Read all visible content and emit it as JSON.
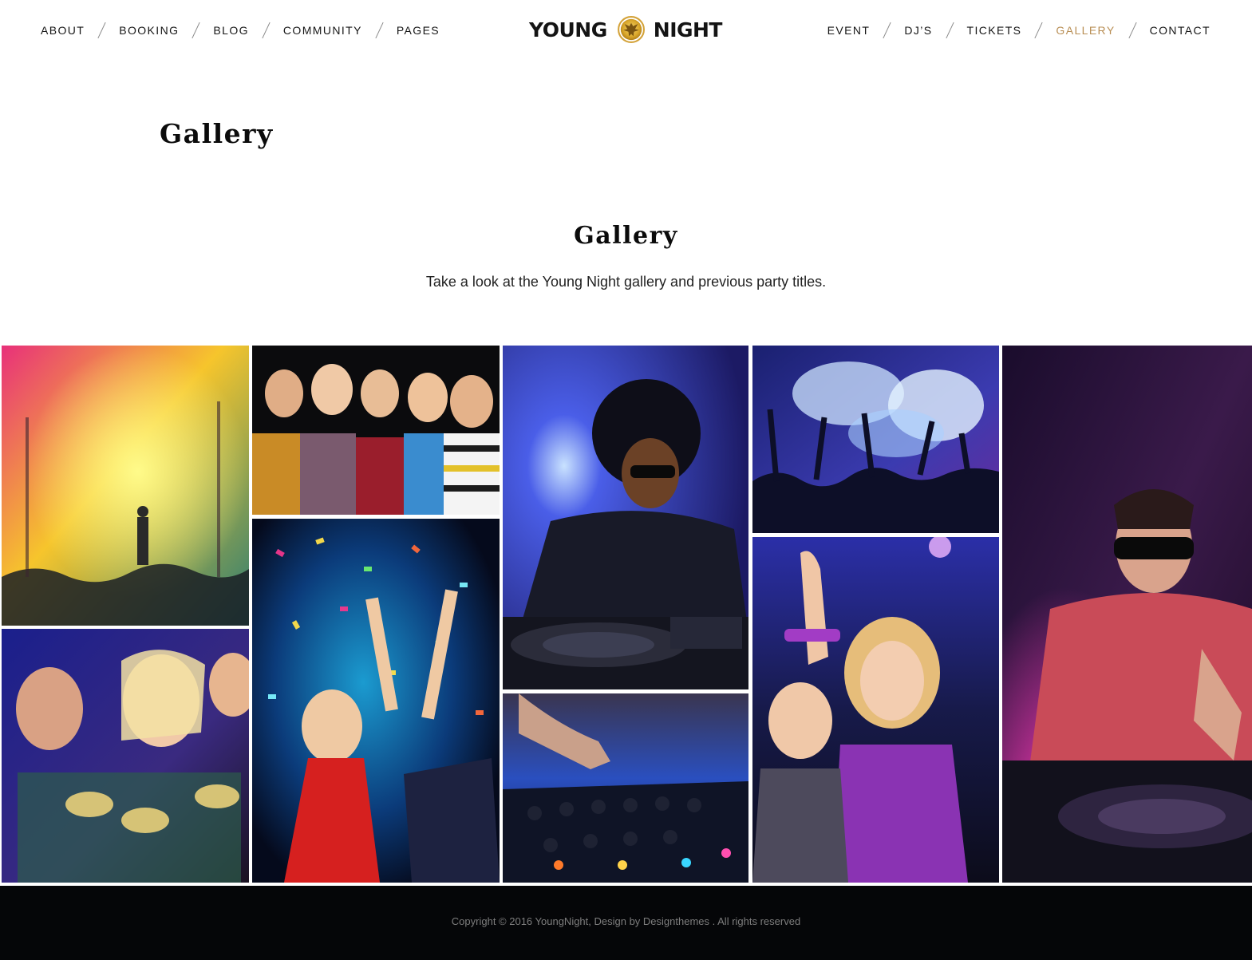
{
  "nav_left": [
    "ABOUT",
    "BOOKING",
    "BLOG",
    "COMMUNITY",
    "PAGES"
  ],
  "nav_right": [
    "EVENT",
    "DJ’S",
    "TICKETS",
    "GALLERY",
    "CONTACT"
  ],
  "nav_active": "GALLERY",
  "logo": {
    "left_word": "YOUNG",
    "right_word": "NIGHT",
    "emblem_icon": "eagle-emblem-icon"
  },
  "page_title": "Gallery",
  "section": {
    "title": "Gallery",
    "subtitle": "Take a look at the Young Night gallery and previous party titles."
  },
  "gallery_items": [
    {
      "subject": "concert-stage-photo"
    },
    {
      "subject": "women-toasting-photo"
    },
    {
      "subject": "friends-party-hats-photo"
    },
    {
      "subject": "confetti-dancing-photo"
    },
    {
      "subject": "dj-afro-turntable-photo"
    },
    {
      "subject": "dj-mixer-hands-photo"
    },
    {
      "subject": "crowd-smoke-photo"
    },
    {
      "subject": "dancing-couple-photo"
    },
    {
      "subject": "dj-sunglasses-photo"
    }
  ],
  "colors": {
    "accent": "#b98f55",
    "footer_bg": "#050608",
    "text": "#161616"
  },
  "footer": {
    "copyright": "Copyright © 2016 YoungNight, Design by Designthemes . All rights reserved"
  }
}
